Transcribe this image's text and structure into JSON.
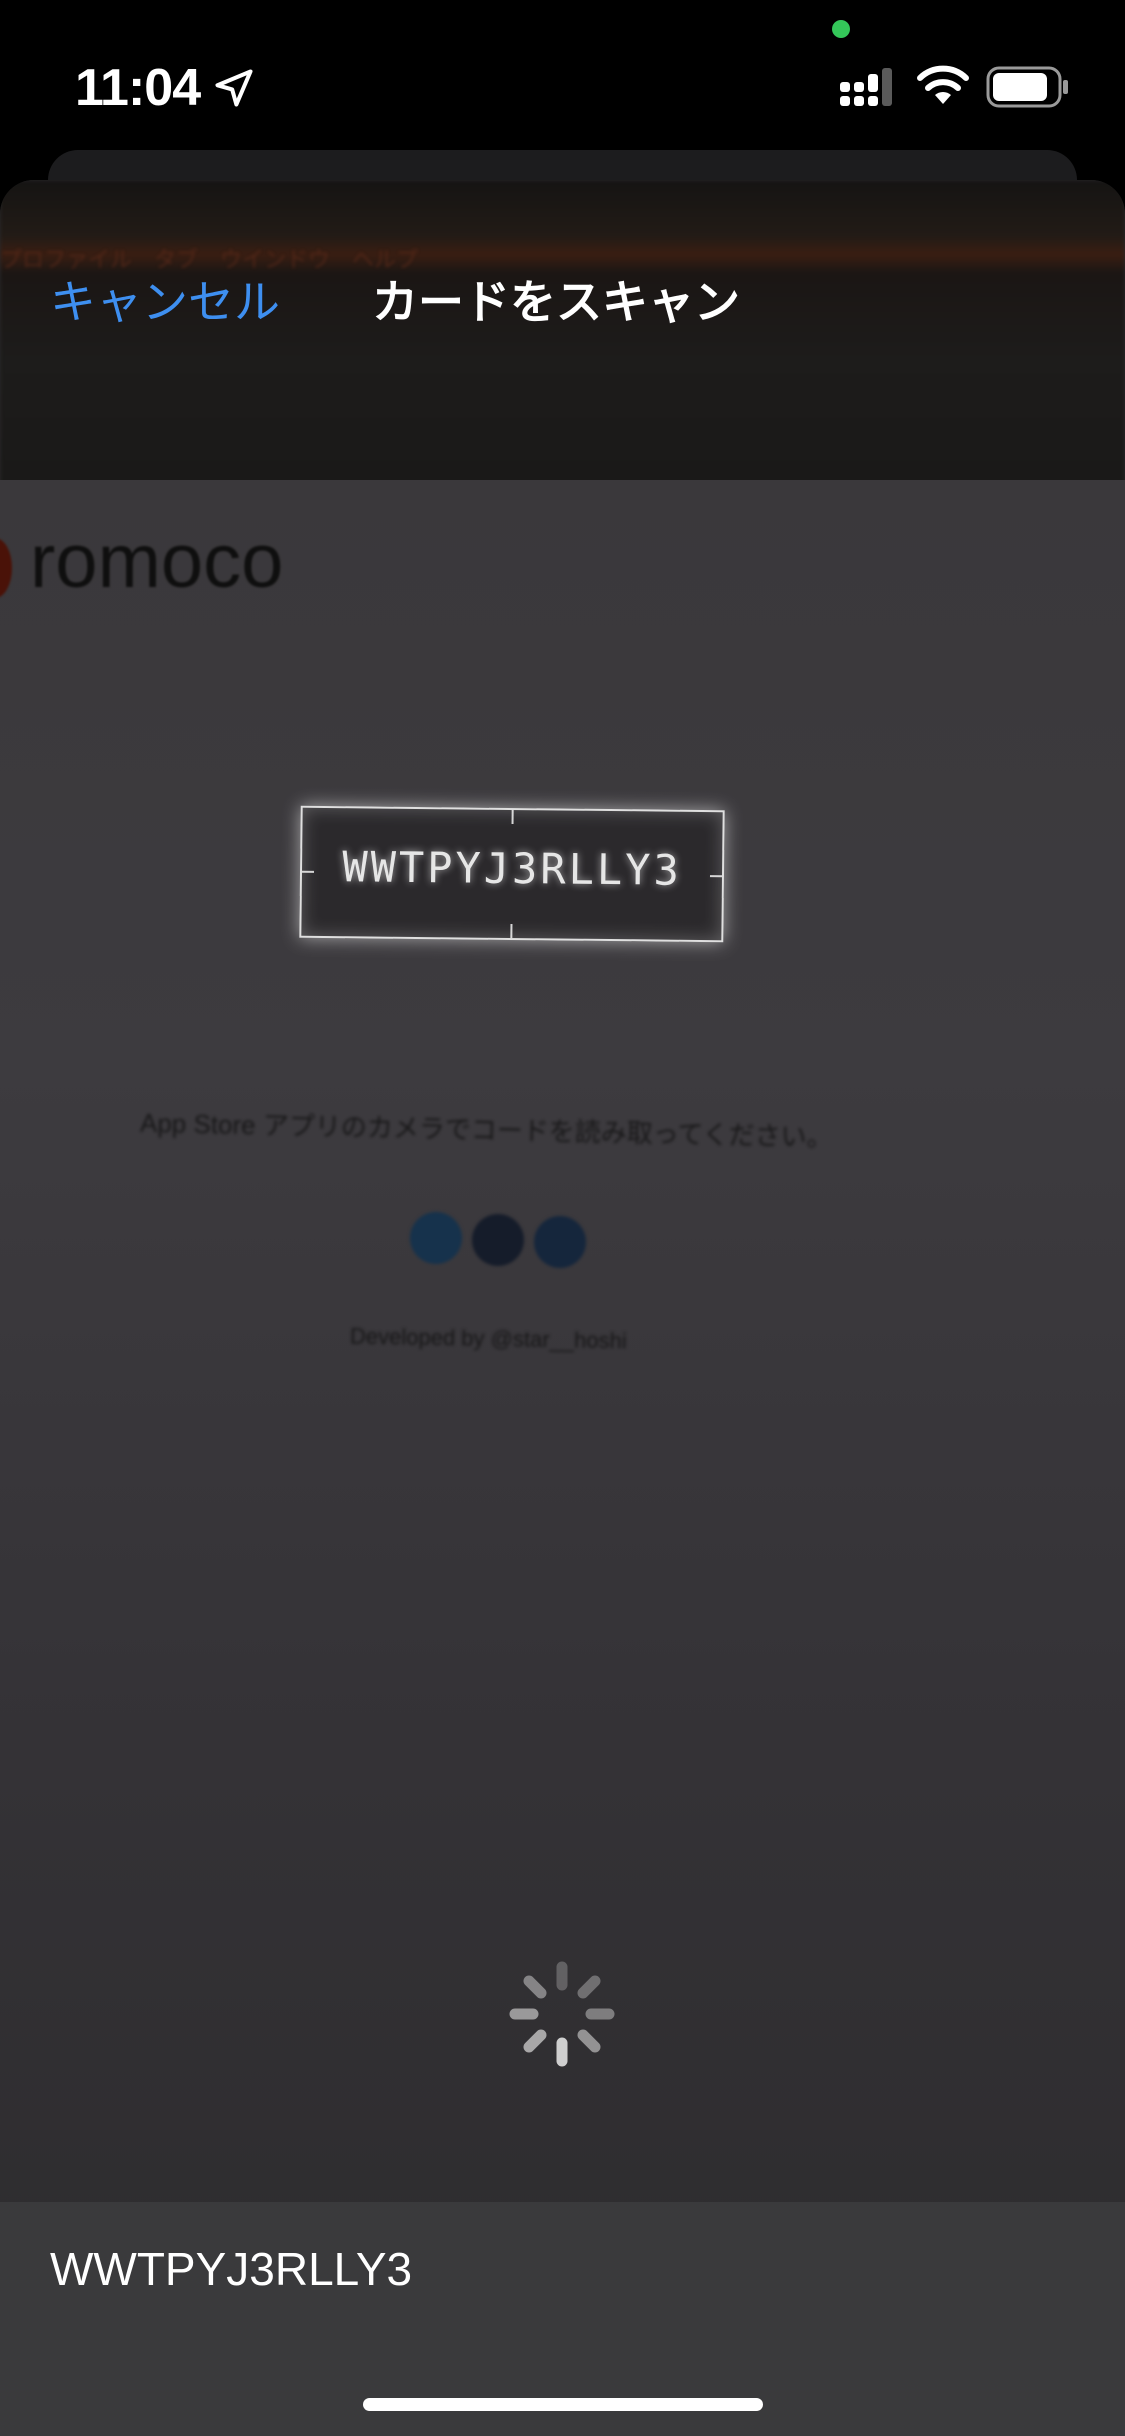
{
  "status_bar": {
    "time": "11:04",
    "recording_dot_color": "#34c759",
    "icons": [
      "location-arrow-icon",
      "cellular-icon",
      "wifi-icon",
      "battery-icon"
    ]
  },
  "header": {
    "cancel_label": "キャンセル",
    "title": "カードをスキャン"
  },
  "camera_view": {
    "background_texts": {
      "brand": "romoco",
      "menu": "プロファイル　タブ　ウインドウ　ヘルプ",
      "instruction": "App Store アプリのカメラでコードを読み取ってください。",
      "developed_by": "Developed by @star__hoshi"
    },
    "detected_code": "WWTPYJ3RLLY3"
  },
  "result": {
    "code": "WWTPYJ3RLLY3"
  },
  "colors": {
    "accent": "#3e8ff0",
    "result_bar": "#3a3a3c"
  }
}
